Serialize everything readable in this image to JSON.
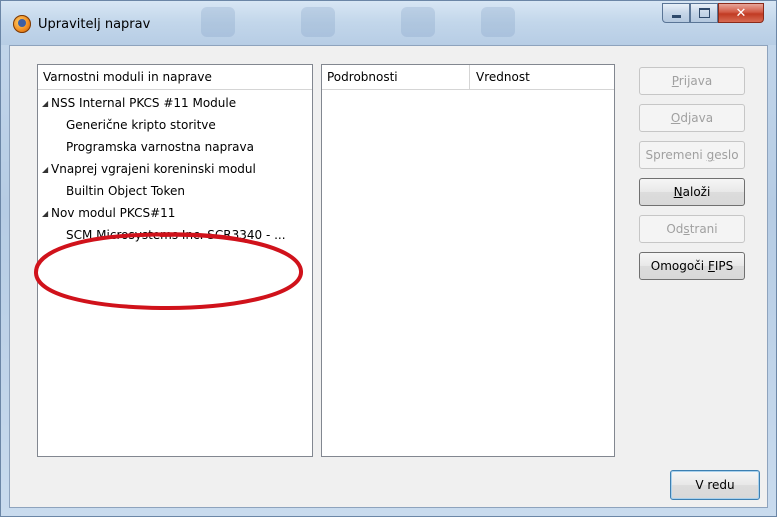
{
  "window": {
    "title": "Upravitelj naprav"
  },
  "caption_buttons": {
    "minimize_icon": "minimize-icon",
    "maximize_icon": "maximize-icon",
    "close_glyph": "✕"
  },
  "tree": {
    "header": "Varnostni moduli in naprave",
    "items": [
      {
        "label": "NSS Internal PKCS #11 Module",
        "level": 0,
        "twisty": "◢"
      },
      {
        "label": "Generične kripto storitve",
        "level": 1
      },
      {
        "label": "Programska varnostna naprava",
        "level": 1
      },
      {
        "label": "Vnaprej vgrajeni koreninski modul",
        "level": 0,
        "twisty": "◢"
      },
      {
        "label": "Builtin Object Token",
        "level": 1
      },
      {
        "label": "Nov modul PKCS#11",
        "level": 0,
        "twisty": "◢"
      },
      {
        "label": "SCM Microsystems Inc. SCR3340 - ...",
        "level": 1
      }
    ]
  },
  "details": {
    "col1": "Podrobnosti",
    "col2": "Vrednost"
  },
  "buttons": {
    "login": {
      "pre": "",
      "accel": "P",
      "post": "rijava"
    },
    "logout": {
      "pre": "",
      "accel": "O",
      "post": "djava"
    },
    "change_password": {
      "pre": "Spremeni ",
      "accel": "g",
      "post": "eslo"
    },
    "load": {
      "pre": "",
      "accel": "N",
      "post": "aloži"
    },
    "remove": {
      "pre": "Od",
      "accel": "s",
      "post": "trani"
    },
    "fips": {
      "pre": "Omogoči ",
      "accel": "F",
      "post": "IPS"
    },
    "ok": "V redu"
  },
  "annotation_color": "#d0121b"
}
